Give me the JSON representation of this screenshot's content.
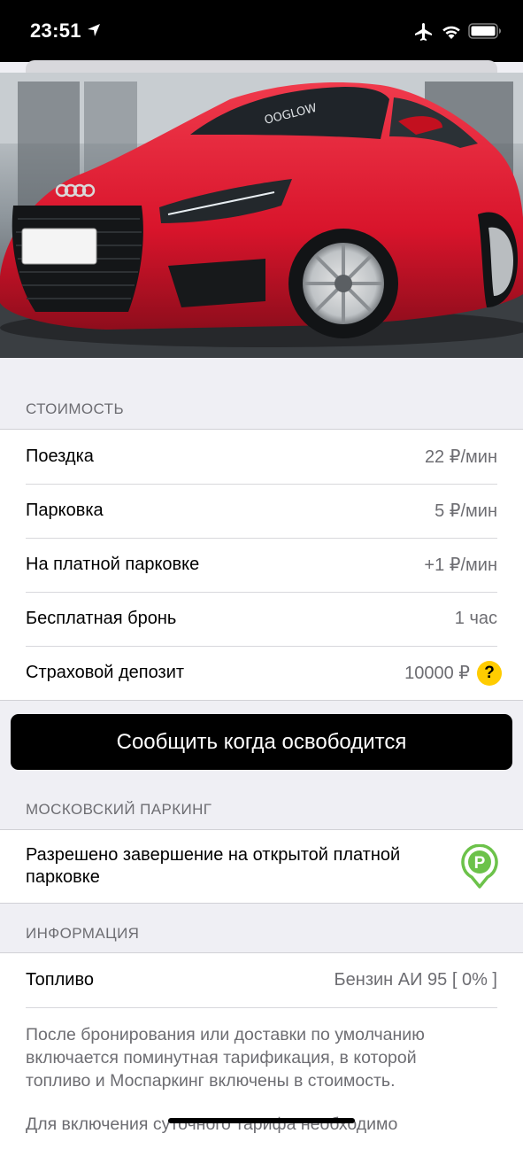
{
  "status_bar": {
    "time": "23:51",
    "icons": [
      "location-arrow-icon",
      "airplane-icon",
      "wifi-icon",
      "battery-icon"
    ]
  },
  "carousel": {
    "total_pages": 10,
    "active_page": 1,
    "plate_visible": true
  },
  "cost": {
    "header": "СТОИМОСТЬ",
    "rows": [
      {
        "label": "Поездка",
        "value": "22 ₽/мин"
      },
      {
        "label": "Парковка",
        "value": "5 ₽/мин"
      },
      {
        "label": "На платной парковке",
        "value": "+1 ₽/мин"
      },
      {
        "label": "Бесплатная бронь",
        "value": "1 час"
      },
      {
        "label": "Страховой депозит",
        "value": "10000 ₽"
      }
    ],
    "help_glyph": "?"
  },
  "notify_button": {
    "label": "Сообщить когда освободится"
  },
  "parking": {
    "header": "МОСКОВСКИЙ ПАРКИНГ",
    "text": "Разрешено завершение на открытой платной парковке",
    "icon_glyph": "P",
    "icon_color": "#6cc24a"
  },
  "info": {
    "header": "ИНФОРМАЦИЯ",
    "fuel_label": "Топливо",
    "fuel_value": "Бензин АИ 95 [ 0% ]",
    "paragraph1": "После бронирования или доставки по умолчанию включается поминутная тарификация, в которой топливо и Моспаркинг включены в стоимость.",
    "paragraph2": "Для включения суточного тарифа необходимо"
  },
  "colors": {
    "accent": "#ffcc00",
    "background": "#efeff4",
    "secondary_text": "#6d6d72",
    "car": "#d8142b"
  }
}
